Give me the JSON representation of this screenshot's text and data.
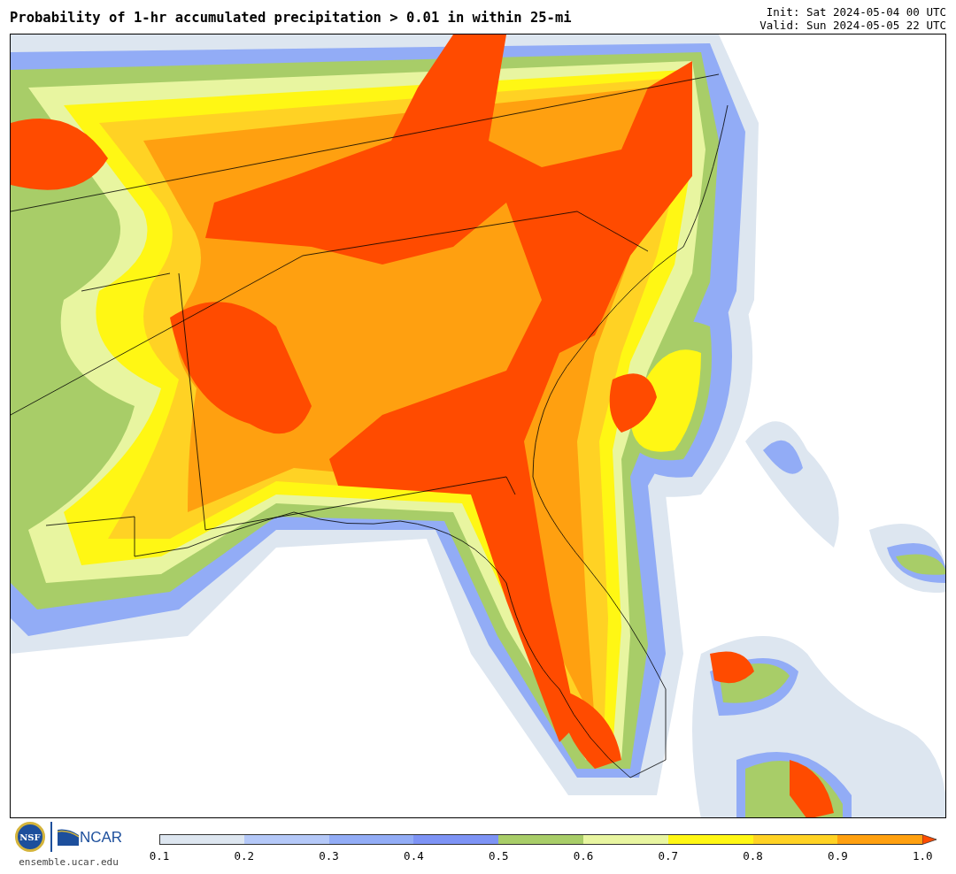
{
  "title": "Probability of 1-hr accumulated precipitation > 0.01 in within 25-mi",
  "init": "Init: Sat 2024-05-04 00 UTC",
  "valid": "Valid: Sun 2024-05-05 22 UTC",
  "logos": {
    "nsf": "NSF",
    "ncar": "NCAR",
    "url": "ensemble.ucar.edu"
  },
  "colorbar": {
    "bins": [
      {
        "kind": "bin",
        "color": "#dde6f0"
      },
      {
        "kind": "bin",
        "color": "#b4c8f8"
      },
      {
        "kind": "bin",
        "color": "#92acf6"
      },
      {
        "kind": "bin",
        "color": "#7d93f5"
      },
      {
        "kind": "bin",
        "color": "#a8cd68"
      },
      {
        "kind": "bin",
        "color": "#e8f5a0"
      },
      {
        "kind": "bin",
        "color": "#fff714"
      },
      {
        "kind": "bin",
        "color": "#ffd224"
      },
      {
        "kind": "bin",
        "color": "#ffa010"
      },
      {
        "kind": "arrow",
        "color": "#ff4b00"
      }
    ],
    "ticks": [
      "0.1",
      "0.2",
      "0.3",
      "0.4",
      "0.5",
      "0.6",
      "0.7",
      "0.8",
      "0.9",
      "1.0"
    ]
  }
}
